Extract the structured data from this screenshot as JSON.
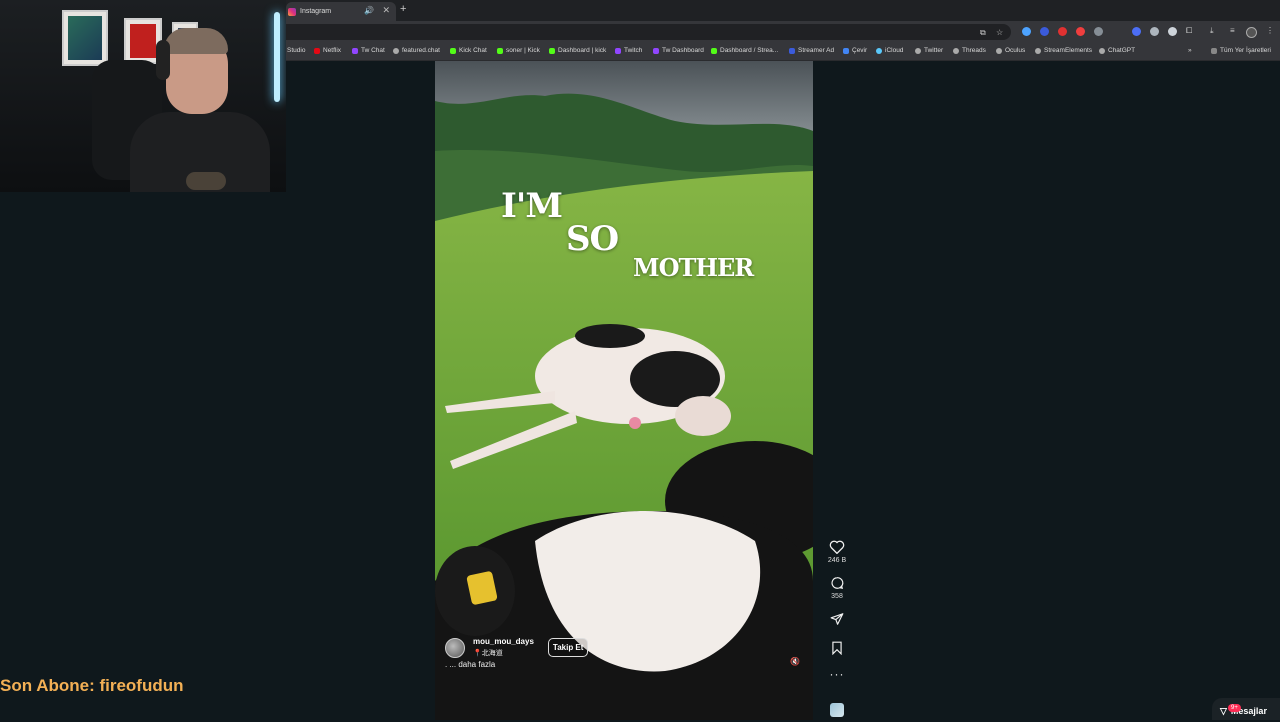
{
  "browser": {
    "tab": {
      "title": "Instagram"
    },
    "bookmarks": [
      {
        "label": "Studio",
        "color": "#cccccc"
      },
      {
        "label": "Netflix",
        "color": "#e50914"
      },
      {
        "label": "Tw Chat",
        "color": "#9146ff"
      },
      {
        "label": "featured.chat",
        "color": "#aaaaaa"
      },
      {
        "label": "Kick Chat",
        "color": "#53fc18"
      },
      {
        "label": "soner | Kick",
        "color": "#53fc18"
      },
      {
        "label": "Dashboard | kick",
        "color": "#53fc18"
      },
      {
        "label": "Twitch",
        "color": "#9146ff"
      },
      {
        "label": "Tw Dashboard",
        "color": "#9146ff"
      },
      {
        "label": "Dashboard / Strea...",
        "color": "#53fc18"
      },
      {
        "label": "Streamer Ad",
        "color": "#3b5bdb"
      },
      {
        "label": "Çevir",
        "color": "#4285f4"
      },
      {
        "label": "iCloud",
        "color": "#5ac8fa"
      },
      {
        "label": "Twitter",
        "color": "#aaaaaa"
      },
      {
        "label": "Threads",
        "color": "#aaaaaa"
      },
      {
        "label": "Oculus",
        "color": "#aaaaaa"
      },
      {
        "label": "StreamElements",
        "color": "#aaaaaa"
      },
      {
        "label": "ChatGPT",
        "color": "#aaaaaa"
      }
    ],
    "all_bookmarks": "Tüm Yer İşaretleri"
  },
  "reel": {
    "overlay_lines": [
      "I'M",
      "SO",
      "MOTHER"
    ],
    "username": "mou_mou_days",
    "location": "北海道",
    "follow_label": "Takip Et",
    "caption": ". ... daha fazla",
    "likes": "246 B",
    "comments": "358"
  },
  "stream": {
    "last_subscriber": "Son Abone: fireofudun",
    "messages_label": "Mesajlar",
    "messages_badge": "9+"
  },
  "icons": [
    "heart-icon",
    "comment-icon",
    "share-icon",
    "bookmark-icon",
    "more-icon",
    "mute-icon",
    "location-pin-icon"
  ]
}
